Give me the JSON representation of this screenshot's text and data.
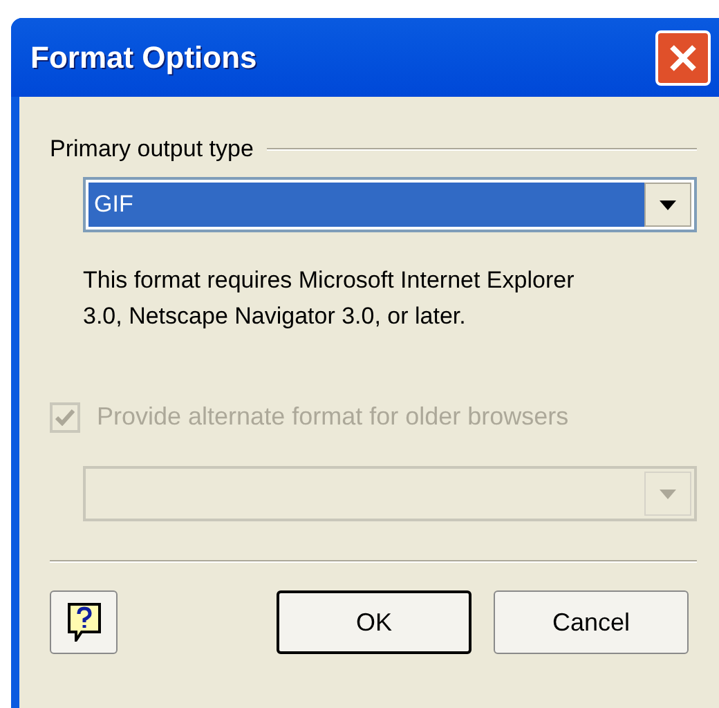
{
  "window": {
    "title": "Format Options"
  },
  "primary_output": {
    "label": "Primary output type",
    "value": "GIF",
    "focused": true
  },
  "description": "This format requires Microsoft Internet Explorer 3.0, Netscape Navigator 3.0, or later.",
  "alternate": {
    "label": "Provide alternate format for older browsers",
    "checked": true,
    "disabled": true
  },
  "alternate_format": {
    "disabled": true
  },
  "buttons": [
    {
      "kind": "help"
    },
    {
      "kind": "default",
      "label": "OK"
    },
    {
      "kind": "normal",
      "label": "Cancel"
    }
  ]
}
